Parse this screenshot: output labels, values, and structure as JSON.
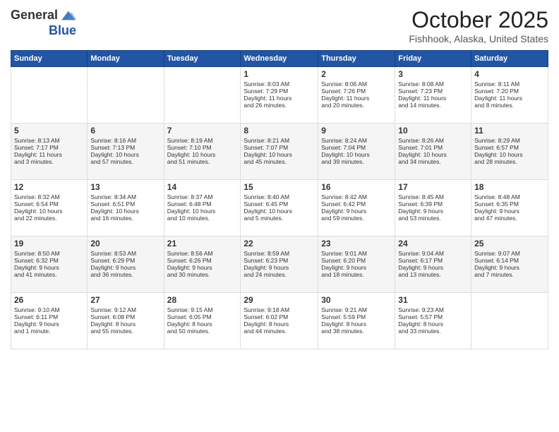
{
  "header": {
    "logo_general": "General",
    "logo_blue": "Blue",
    "month_title": "October 2025",
    "location": "Fishhook, Alaska, United States"
  },
  "days_of_week": [
    "Sunday",
    "Monday",
    "Tuesday",
    "Wednesday",
    "Thursday",
    "Friday",
    "Saturday"
  ],
  "weeks": [
    [
      {
        "day": "",
        "info": ""
      },
      {
        "day": "",
        "info": ""
      },
      {
        "day": "",
        "info": ""
      },
      {
        "day": "1",
        "info": "Sunrise: 8:03 AM\nSunset: 7:29 PM\nDaylight: 11 hours\nand 26 minutes."
      },
      {
        "day": "2",
        "info": "Sunrise: 8:06 AM\nSunset: 7:26 PM\nDaylight: 11 hours\nand 20 minutes."
      },
      {
        "day": "3",
        "info": "Sunrise: 8:08 AM\nSunset: 7:23 PM\nDaylight: 11 hours\nand 14 minutes."
      },
      {
        "day": "4",
        "info": "Sunrise: 8:11 AM\nSunset: 7:20 PM\nDaylight: 11 hours\nand 8 minutes."
      }
    ],
    [
      {
        "day": "5",
        "info": "Sunrise: 8:13 AM\nSunset: 7:17 PM\nDaylight: 11 hours\nand 3 minutes."
      },
      {
        "day": "6",
        "info": "Sunrise: 8:16 AM\nSunset: 7:13 PM\nDaylight: 10 hours\nand 57 minutes."
      },
      {
        "day": "7",
        "info": "Sunrise: 8:19 AM\nSunset: 7:10 PM\nDaylight: 10 hours\nand 51 minutes."
      },
      {
        "day": "8",
        "info": "Sunrise: 8:21 AM\nSunset: 7:07 PM\nDaylight: 10 hours\nand 45 minutes."
      },
      {
        "day": "9",
        "info": "Sunrise: 8:24 AM\nSunset: 7:04 PM\nDaylight: 10 hours\nand 39 minutes."
      },
      {
        "day": "10",
        "info": "Sunrise: 8:26 AM\nSunset: 7:01 PM\nDaylight: 10 hours\nand 34 minutes."
      },
      {
        "day": "11",
        "info": "Sunrise: 8:29 AM\nSunset: 6:57 PM\nDaylight: 10 hours\nand 28 minutes."
      }
    ],
    [
      {
        "day": "12",
        "info": "Sunrise: 8:32 AM\nSunset: 6:54 PM\nDaylight: 10 hours\nand 22 minutes."
      },
      {
        "day": "13",
        "info": "Sunrise: 8:34 AM\nSunset: 6:51 PM\nDaylight: 10 hours\nand 16 minutes."
      },
      {
        "day": "14",
        "info": "Sunrise: 8:37 AM\nSunset: 6:48 PM\nDaylight: 10 hours\nand 10 minutes."
      },
      {
        "day": "15",
        "info": "Sunrise: 8:40 AM\nSunset: 6:45 PM\nDaylight: 10 hours\nand 5 minutes."
      },
      {
        "day": "16",
        "info": "Sunrise: 8:42 AM\nSunset: 6:42 PM\nDaylight: 9 hours\nand 59 minutes."
      },
      {
        "day": "17",
        "info": "Sunrise: 8:45 AM\nSunset: 6:39 PM\nDaylight: 9 hours\nand 53 minutes."
      },
      {
        "day": "18",
        "info": "Sunrise: 8:48 AM\nSunset: 6:35 PM\nDaylight: 9 hours\nand 47 minutes."
      }
    ],
    [
      {
        "day": "19",
        "info": "Sunrise: 8:50 AM\nSunset: 6:32 PM\nDaylight: 9 hours\nand 41 minutes."
      },
      {
        "day": "20",
        "info": "Sunrise: 8:53 AM\nSunset: 6:29 PM\nDaylight: 9 hours\nand 36 minutes."
      },
      {
        "day": "21",
        "info": "Sunrise: 8:56 AM\nSunset: 6:26 PM\nDaylight: 9 hours\nand 30 minutes."
      },
      {
        "day": "22",
        "info": "Sunrise: 8:59 AM\nSunset: 6:23 PM\nDaylight: 9 hours\nand 24 minutes."
      },
      {
        "day": "23",
        "info": "Sunrise: 9:01 AM\nSunset: 6:20 PM\nDaylight: 9 hours\nand 18 minutes."
      },
      {
        "day": "24",
        "info": "Sunrise: 9:04 AM\nSunset: 6:17 PM\nDaylight: 9 hours\nand 13 minutes."
      },
      {
        "day": "25",
        "info": "Sunrise: 9:07 AM\nSunset: 6:14 PM\nDaylight: 9 hours\nand 7 minutes."
      }
    ],
    [
      {
        "day": "26",
        "info": "Sunrise: 9:10 AM\nSunset: 6:11 PM\nDaylight: 9 hours\nand 1 minute."
      },
      {
        "day": "27",
        "info": "Sunrise: 9:12 AM\nSunset: 6:08 PM\nDaylight: 8 hours\nand 55 minutes."
      },
      {
        "day": "28",
        "info": "Sunrise: 9:15 AM\nSunset: 6:05 PM\nDaylight: 8 hours\nand 50 minutes."
      },
      {
        "day": "29",
        "info": "Sunrise: 9:18 AM\nSunset: 6:02 PM\nDaylight: 8 hours\nand 44 minutes."
      },
      {
        "day": "30",
        "info": "Sunrise: 9:21 AM\nSunset: 5:59 PM\nDaylight: 8 hours\nand 38 minutes."
      },
      {
        "day": "31",
        "info": "Sunrise: 9:23 AM\nSunset: 5:57 PM\nDaylight: 8 hours\nand 33 minutes."
      },
      {
        "day": "",
        "info": ""
      }
    ]
  ]
}
